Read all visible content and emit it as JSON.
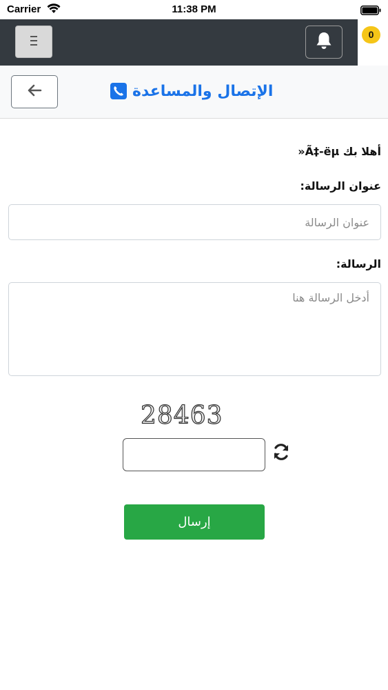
{
  "status_bar": {
    "carrier": "Carrier",
    "time": "11:38 PM"
  },
  "nav": {
    "menu_icon": "hamburger-icon",
    "bell_icon": "bell-icon",
    "notification_count": "0",
    "badge_color": "#f5c518",
    "nav_color": "#343a40"
  },
  "header": {
    "title": "الإتصال والمساعدة",
    "title_color": "#1a73e8",
    "back_icon": "arrow-left-icon",
    "title_icon": "phone-icon"
  },
  "form": {
    "greeting": "أهلا بك Ã‡-ëµ«",
    "subject_label": "عنوان الرسالة:",
    "subject_placeholder": "عنوان الرسالة",
    "message_label": "الرسالة:",
    "message_placeholder": "أدخل الرسالة هنا",
    "captcha_code": "28463",
    "captcha_input_value": "",
    "refresh_icon": "refresh-icon",
    "submit_label": "إرسال",
    "submit_color": "#28a745"
  }
}
